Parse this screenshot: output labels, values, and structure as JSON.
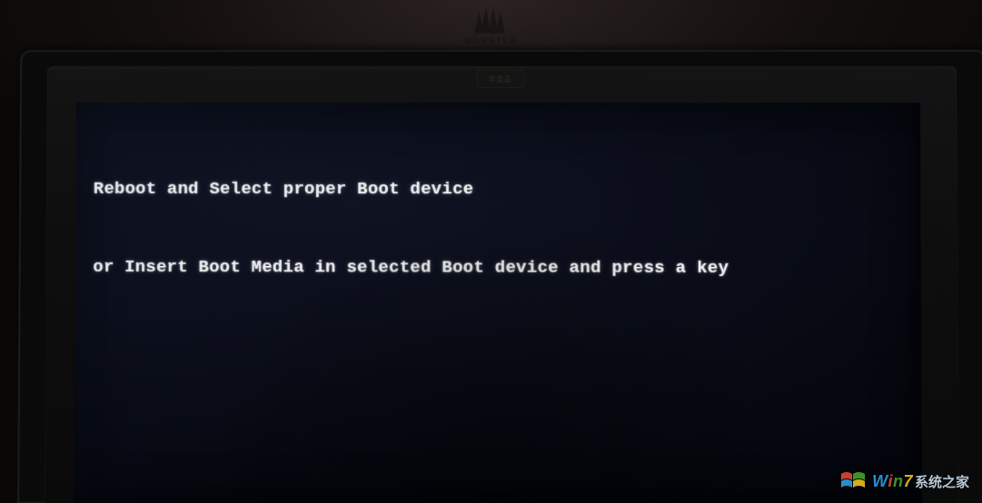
{
  "wall_sticker": {
    "label": "MONSTER"
  },
  "bezel": {
    "info_label": "非卖品"
  },
  "bios": {
    "line1": "Reboot and Select proper Boot device",
    "line2": "or Insert Boot Media in selected Boot device and press a key"
  },
  "watermark": {
    "brand": "Win7",
    "tail": "系统之家"
  }
}
